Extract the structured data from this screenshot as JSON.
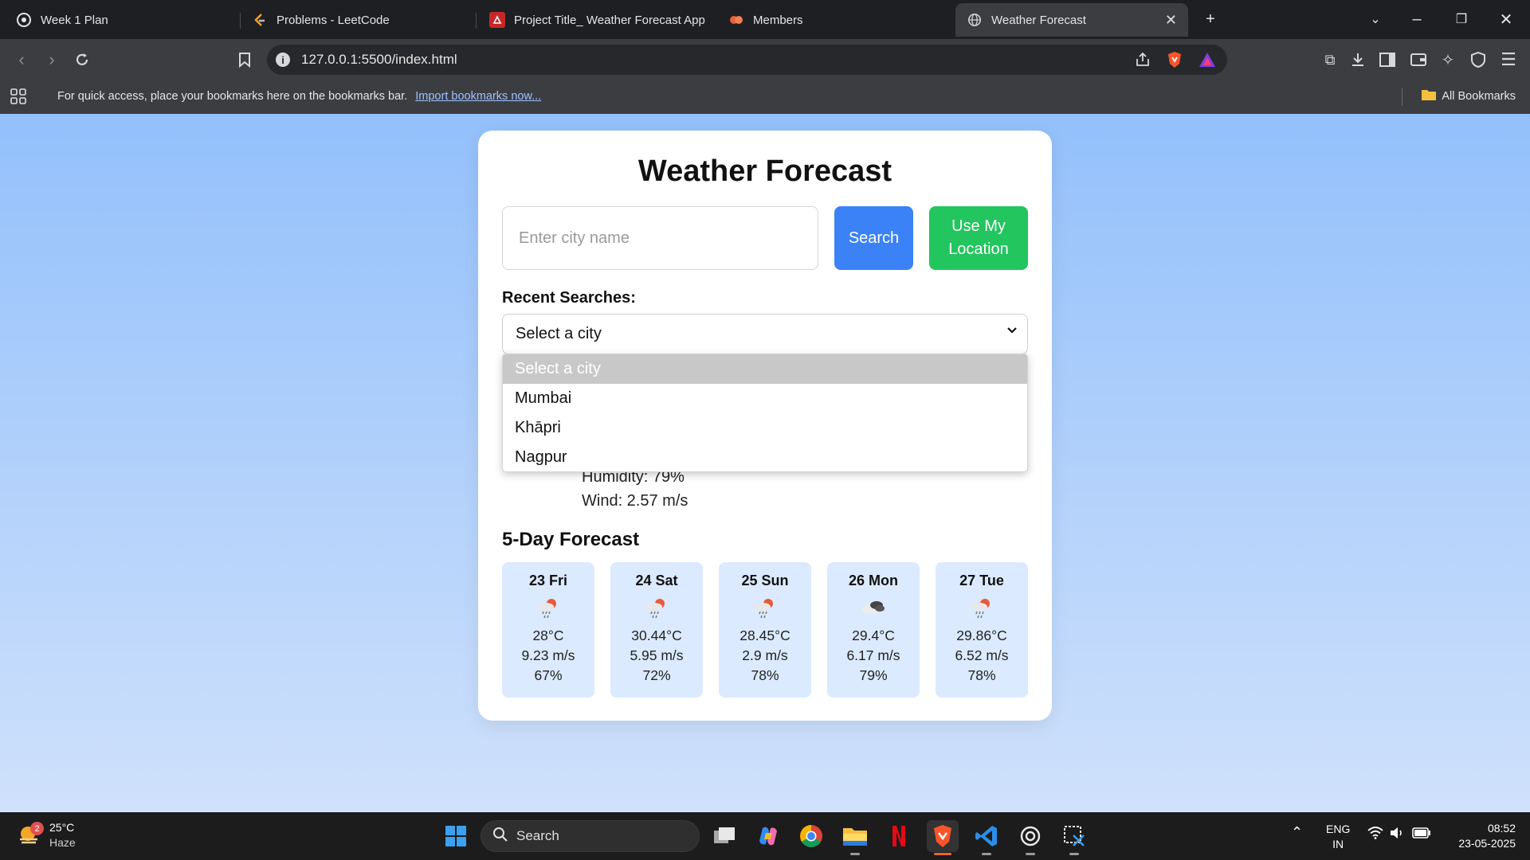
{
  "browser": {
    "tabs": [
      {
        "title": "Week 1 Plan",
        "icon": "openai-icon"
      },
      {
        "title": "Problems - LeetCode",
        "icon": "leetcode-icon"
      },
      {
        "title": "Project Title_ Weather Forecast App",
        "icon": "pdf-icon"
      },
      {
        "title": "Members",
        "icon": "members-icon"
      },
      {
        "title": "Weather Forecast",
        "icon": "globe-icon",
        "active": true
      }
    ],
    "new_tab": "+",
    "url": "127.0.0.1:5500/index.html",
    "bookmarks_message": "For quick access, place your bookmarks here on the bookmarks bar.",
    "bookmarks_link": "Import bookmarks now...",
    "all_bookmarks": "All Bookmarks"
  },
  "app": {
    "title": "Weather Forecast",
    "city_placeholder": "Enter city name",
    "search_label": "Search",
    "location_label": "Use My Location",
    "recent_label": "Recent Searches:",
    "select_value": "Select a city",
    "dropdown_options": [
      "Select a city",
      "Mumbai",
      "Khāpri",
      "Nagpur"
    ],
    "current": {
      "humidity": "Humidity: 79%",
      "wind": "Wind: 2.57 m/s"
    },
    "forecast_title": "5-Day Forecast",
    "forecast": [
      {
        "day": "23 Fri",
        "icon": "rain-cloud-icon",
        "temp": "28°C",
        "wind": "9.23 m/s",
        "humidity": "67%"
      },
      {
        "day": "24 Sat",
        "icon": "rain-cloud-icon",
        "temp": "30.44°C",
        "wind": "5.95 m/s",
        "humidity": "72%"
      },
      {
        "day": "25 Sun",
        "icon": "rain-cloud-icon",
        "temp": "28.45°C",
        "wind": "2.9 m/s",
        "humidity": "78%"
      },
      {
        "day": "26 Mon",
        "icon": "broken-clouds-icon",
        "temp": "29.4°C",
        "wind": "6.17 m/s",
        "humidity": "79%"
      },
      {
        "day": "27 Tue",
        "icon": "rain-cloud-icon",
        "temp": "29.86°C",
        "wind": "6.52 m/s",
        "humidity": "78%"
      }
    ]
  },
  "taskbar": {
    "weather_temp": "25°C",
    "weather_desc": "Haze",
    "weather_badge": "2",
    "search_label": "Search",
    "language_line1": "ENG",
    "language_line2": "IN",
    "time": "08:52",
    "date": "23-05-2025"
  },
  "colors": {
    "search_button": "#3b82f6",
    "location_button": "#22c55e",
    "forecast_card": "#dbeafe",
    "page_gradient_top": "#93c0fb"
  }
}
